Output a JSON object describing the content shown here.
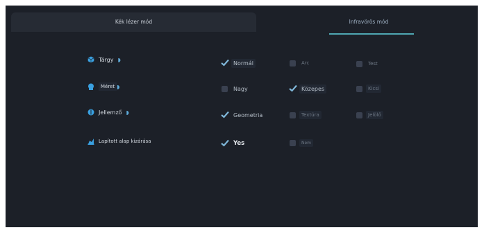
{
  "tabs": {
    "blue_laser": "Kék lézer mód",
    "infrared": "Infravörös mód"
  },
  "rows": [
    {
      "label": "Tárgy",
      "options": [
        "Normál",
        "Arc",
        "Test"
      ],
      "checked": [
        true,
        false,
        false
      ]
    },
    {
      "label": "Méret",
      "options": [
        "Nagy",
        "Közepes",
        "Kicsi"
      ],
      "checked": [
        false,
        true,
        false
      ]
    },
    {
      "label": "Jellemző",
      "options": [
        "Geometria",
        "Textúra",
        "Jelölő"
      ],
      "checked": [
        true,
        false,
        false
      ]
    },
    {
      "label": "Lapított alap kizárása",
      "options": [
        "Yes",
        "Nem"
      ],
      "checked": [
        true,
        false
      ]
    }
  ],
  "colors": {
    "accent": "#4fa7b3",
    "icon": "#3aa0e0",
    "check": "#7fb7d9",
    "background": "#1c2028"
  },
  "icons": [
    "cube-icon",
    "head-icon",
    "layers-icon",
    "flat-base-icon",
    "moon-icon",
    "checkmark-icon"
  ]
}
